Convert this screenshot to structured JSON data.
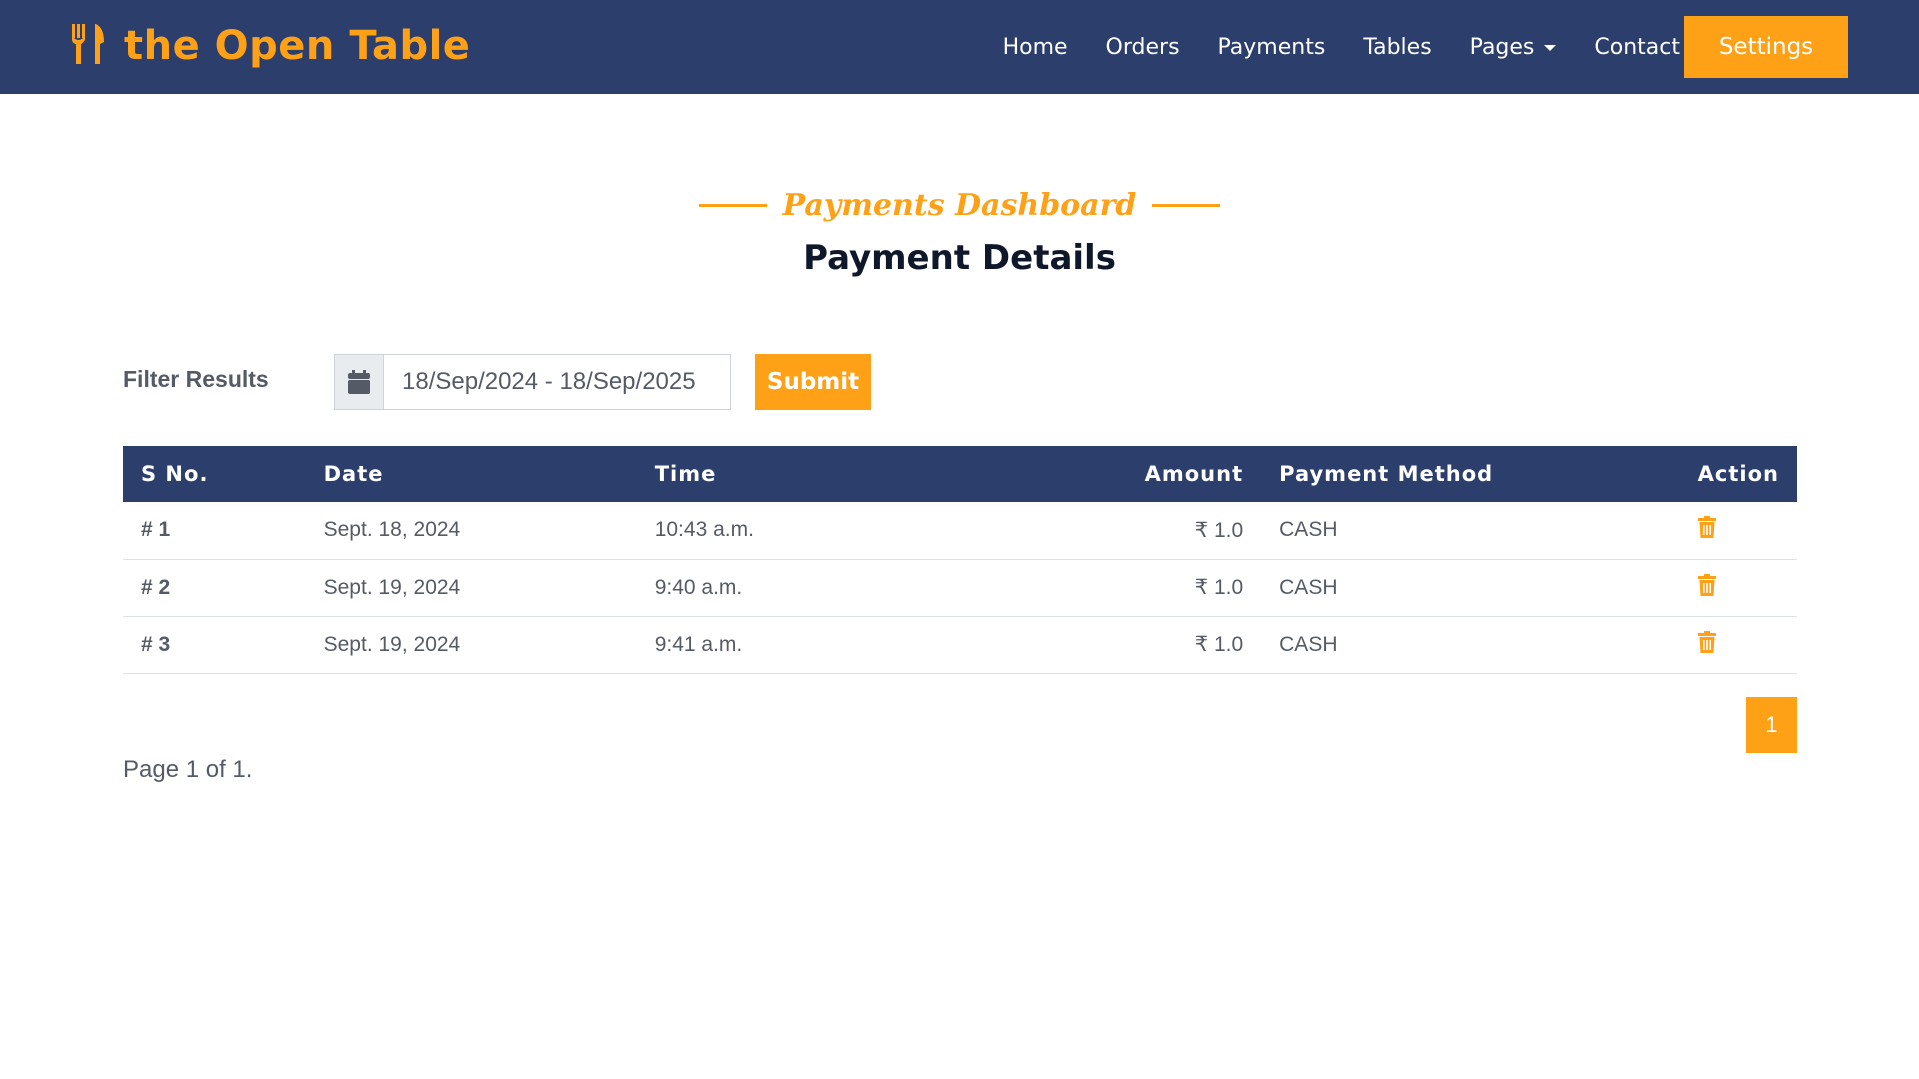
{
  "navbar": {
    "brand": "the Open Table",
    "brand_icon": "utensils-icon",
    "links": [
      "Home",
      "Orders",
      "Payments",
      "Tables",
      "Pages",
      "Contact"
    ],
    "settings_label": "Settings"
  },
  "header": {
    "subtitle": "Payments Dashboard",
    "title": "Payment Details"
  },
  "filter": {
    "label": "Filter Results",
    "date_range": "18/Sep/2024 - 18/Sep/2025",
    "submit_label": "Submit"
  },
  "table": {
    "columns": [
      "S No.",
      "Date",
      "Time",
      "Amount",
      "Payment Method",
      "Action"
    ],
    "rows": [
      {
        "sno": "# 1",
        "date": "Sept. 18, 2024",
        "time": "10:43 a.m.",
        "amount": "₹ 1.0",
        "method": "CASH"
      },
      {
        "sno": "# 2",
        "date": "Sept. 19, 2024",
        "time": "9:40 a.m.",
        "amount": "₹ 1.0",
        "method": "CASH"
      },
      {
        "sno": "# 3",
        "date": "Sept. 19, 2024",
        "time": "9:41 a.m.",
        "amount": "₹ 1.0",
        "method": "CASH"
      }
    ]
  },
  "pagination": {
    "current_page": "1",
    "page_info": "Page 1 of 1."
  },
  "colors": {
    "primary": "#fea116",
    "navbar": "#2c3e6b",
    "title": "#0f172b"
  }
}
